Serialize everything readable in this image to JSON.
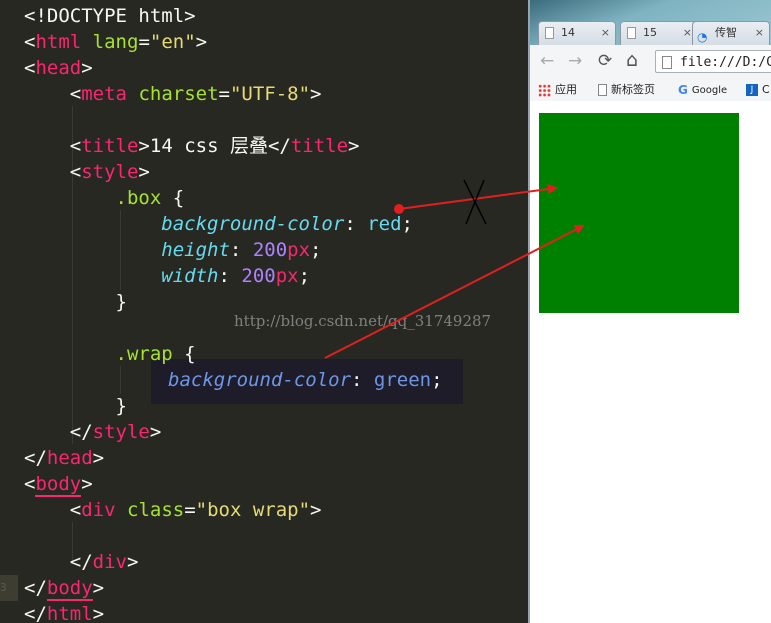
{
  "editor": {
    "gutter_numbers": [
      "",
      "",
      "",
      "",
      "",
      "",
      "",
      "",
      "",
      "",
      "",
      "",
      "",
      "",
      "",
      "",
      "",
      "",
      "",
      "",
      "",
      "",
      "3",
      ""
    ],
    "lines": {
      "doctype": "<!DOCTYPE html>",
      "html_open_tag": "html",
      "html_lang_attr": "lang",
      "html_lang_val": "\"en\"",
      "head_open": "head",
      "meta_tag": "meta",
      "meta_attr": "charset",
      "meta_val": "\"UTF-8\"",
      "title_tag": "title",
      "title_text": "14 css 层叠",
      "style_tag": "style",
      "box_selector": ".box",
      "bg_prop": "background-color",
      "bg_red": "red",
      "height_prop": "height",
      "width_prop": "width",
      "num_200": "200",
      "unit_px": "px",
      "wrap_selector": ".wrap",
      "bg_green": "green",
      "head_close": "head",
      "body_tag": "body",
      "div_tag": "div",
      "class_attr": "class",
      "class_val": "\"box wrap\"",
      "html_close": "html"
    },
    "watermark": "http://blog.csdn.net/qq_31749287"
  },
  "browser": {
    "tabs": [
      {
        "label": "14",
        "close": "×"
      },
      {
        "label": "15",
        "close": "×"
      },
      {
        "label": "传智",
        "close": "×"
      }
    ],
    "nav": {
      "back": "←",
      "forward": "→",
      "reload": "⟳",
      "home": "⌂"
    },
    "address": "file:///D:/C",
    "bookmarks": [
      {
        "label": "应用",
        "icon": "apps-grid-icon"
      },
      {
        "label": "新标签页",
        "icon": "page-icon"
      },
      {
        "label": "Google",
        "icon": "google-icon"
      },
      {
        "label": "C",
        "icon": "j-icon"
      }
    ],
    "rendered_box_color": "#008000"
  },
  "colors": {
    "editor_bg": "#272822",
    "annotation_red": "#e02020"
  }
}
